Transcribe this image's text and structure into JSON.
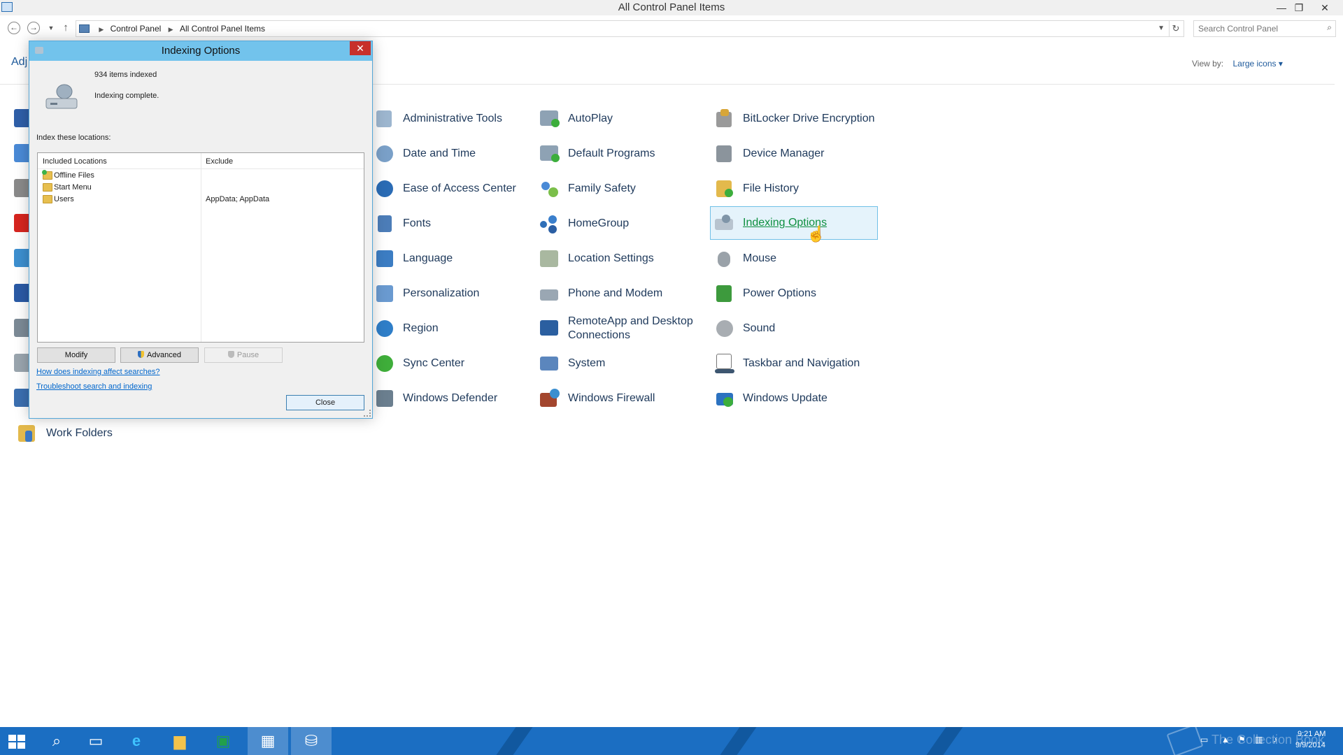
{
  "window": {
    "title": "All Control Panel Items",
    "controls": {
      "minimize": "—",
      "restore": "❐",
      "close": "✕"
    }
  },
  "address": {
    "breadcrumbs": [
      "Control Panel",
      "All Control Panel Items"
    ],
    "search_placeholder": "Search Control Panel"
  },
  "content": {
    "adjust_text": "Adj",
    "view_by_label": "View by:",
    "view_by_value": "Large icons ▾",
    "items": [
      {
        "label": "Administrative Tools",
        "icon": "administrative-tools-icon"
      },
      {
        "label": "AutoPlay",
        "icon": "autoplay-icon"
      },
      {
        "label": "BitLocker Drive Encryption",
        "icon": "bitlocker-icon"
      },
      {
        "label": "Date and Time",
        "icon": "date-time-icon"
      },
      {
        "label": "Default Programs",
        "icon": "default-programs-icon"
      },
      {
        "label": "Device Manager",
        "icon": "device-manager-icon"
      },
      {
        "label": "Ease of Access Center",
        "icon": "ease-of-access-icon"
      },
      {
        "label": "Family Safety",
        "icon": "family-safety-icon"
      },
      {
        "label": "File History",
        "icon": "file-history-icon"
      },
      {
        "label": "Fonts",
        "icon": "fonts-icon"
      },
      {
        "label": "HomeGroup",
        "icon": "homegroup-icon"
      },
      {
        "label": "Indexing Options",
        "icon": "indexing-options-icon"
      },
      {
        "label": "Language",
        "icon": "language-icon"
      },
      {
        "label": "Location Settings",
        "icon": "location-settings-icon"
      },
      {
        "label": "Mouse",
        "icon": "mouse-icon"
      },
      {
        "label": "Personalization",
        "icon": "personalization-icon"
      },
      {
        "label": "Phone and Modem",
        "icon": "phone-modem-icon"
      },
      {
        "label": "Power Options",
        "icon": "power-options-icon"
      },
      {
        "label": "Region",
        "icon": "region-icon"
      },
      {
        "label": "RemoteApp and Desktop Connections",
        "icon": "remoteapp-icon"
      },
      {
        "label": "Sound",
        "icon": "sound-icon"
      },
      {
        "label": "Sync Center",
        "icon": "sync-center-icon"
      },
      {
        "label": "System",
        "icon": "system-icon"
      },
      {
        "label": "Taskbar and Navigation",
        "icon": "taskbar-navigation-icon"
      },
      {
        "label": "Windows Defender",
        "icon": "windows-defender-icon"
      },
      {
        "label": "Windows Firewall",
        "icon": "windows-firewall-icon"
      },
      {
        "label": "Windows Update",
        "icon": "windows-update-icon"
      },
      {
        "label": "Work Folders",
        "icon": "work-folders-icon"
      }
    ],
    "selected_item": "Indexing Options"
  },
  "dialog": {
    "title": "Indexing Options",
    "close_glyph": "✕",
    "items_indexed": "934 items indexed",
    "status": "Indexing complete.",
    "locations_label": "Index these locations:",
    "columns": {
      "included": "Included Locations",
      "exclude": "Exclude"
    },
    "locations": [
      {
        "name": "Offline Files",
        "exclude": ""
      },
      {
        "name": "Start Menu",
        "exclude": ""
      },
      {
        "name": "Users",
        "exclude": "AppData; AppData"
      }
    ],
    "buttons": {
      "modify": "Modify",
      "advanced": "Advanced",
      "pause": "Pause",
      "close": "Close"
    },
    "links": {
      "how_indexing": "How does indexing affect searches?",
      "troubleshoot": "Troubleshoot search and indexing"
    }
  },
  "taskbar": {
    "watermark": "The Collection Book",
    "time": "9:21 AM",
    "date": "9/9/2014"
  },
  "colors": {
    "accent": "#72c3ec",
    "taskbar": "#1b6ec2",
    "link": "#1e395b",
    "selected_link": "#0d8f3f"
  }
}
